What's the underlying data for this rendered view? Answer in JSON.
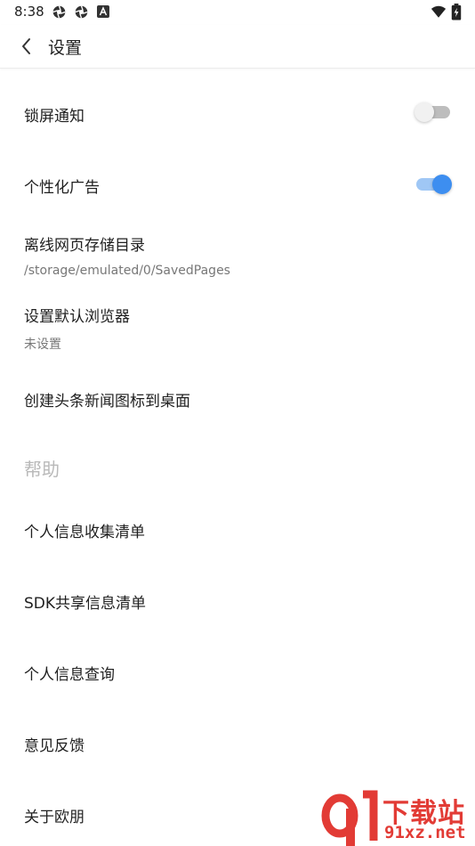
{
  "status_bar": {
    "time": "8:38",
    "left_icons": [
      "aperture-icon",
      "aperture-icon",
      "notification-a-icon"
    ],
    "right_icons": [
      "wifi-icon",
      "battery-charging-icon"
    ]
  },
  "app_bar": {
    "back_icon": "chevron-left-icon",
    "title": "设置"
  },
  "settings": [
    {
      "title": "锁屏通知",
      "toggle": false
    },
    {
      "title": "个性化广告",
      "toggle": true
    },
    {
      "title": "离线网页存储目录",
      "subtitle": "/storage/emulated/0/SavedPages"
    },
    {
      "title": "设置默认浏览器",
      "subtitle": "未设置"
    },
    {
      "title": "创建头条新闻图标到桌面"
    }
  ],
  "help_section": {
    "header": "帮助",
    "items": [
      {
        "title": "个人信息收集清单"
      },
      {
        "title": "SDK共享信息清单"
      },
      {
        "title": "个人信息查询"
      },
      {
        "title": "意见反馈"
      },
      {
        "title": "关于欧朋"
      }
    ]
  },
  "watermark": {
    "text_top": "下载站",
    "text_bottom": "91xz.net"
  },
  "colors": {
    "accent": "#3d8ef0",
    "accent_track": "#9fc7f5",
    "section_header": "#b9b9b9",
    "subtitle": "#777777",
    "watermark": "#e23b35"
  }
}
